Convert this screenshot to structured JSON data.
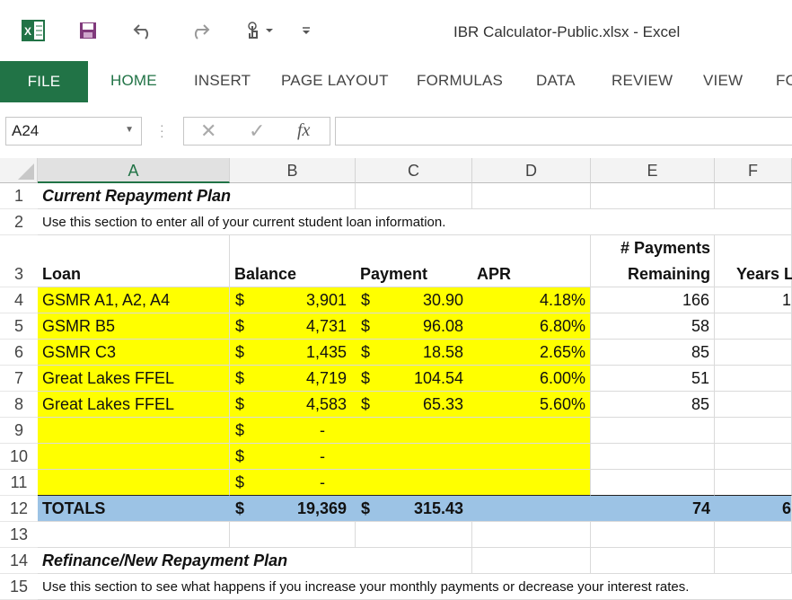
{
  "titlebar": {
    "title": "IBR Calculator-Public.xlsx - Excel"
  },
  "ribbon": {
    "tabs": [
      "FILE",
      "HOME",
      "INSERT",
      "PAGE LAYOUT",
      "FORMULAS",
      "DATA",
      "REVIEW",
      "VIEW",
      "FO"
    ]
  },
  "formula_bar": {
    "name_box": "A24",
    "content": ""
  },
  "columns": [
    "A",
    "B",
    "C",
    "D",
    "E",
    "F"
  ],
  "rows": [
    "1",
    "2",
    "3",
    "4",
    "5",
    "6",
    "7",
    "8",
    "9",
    "10",
    "11",
    "12",
    "13",
    "14",
    "15"
  ],
  "sheet": {
    "r1": {
      "a": "Current Repayment Plan"
    },
    "r2": {
      "a": "Use this section to enter all of your current student loan information."
    },
    "r3": {
      "a": "Loan",
      "b": "Balance",
      "c": "Payment",
      "d": "APR",
      "e1": "# Payments",
      "e2": "Remaining",
      "f": "Years L"
    },
    "loans": [
      {
        "name": "GSMR A1, A2, A4",
        "cur1": "$",
        "balance": "3,901",
        "cur2": "$",
        "payment": "30.90",
        "apr": "4.18%",
        "remaining": "166",
        "years": "1"
      },
      {
        "name": "GSMR B5",
        "cur1": "$",
        "balance": "4,731",
        "cur2": "$",
        "payment": "96.08",
        "apr": "6.80%",
        "remaining": "58",
        "years": ""
      },
      {
        "name": "GSMR C3",
        "cur1": "$",
        "balance": "1,435",
        "cur2": "$",
        "payment": "18.58",
        "apr": "2.65%",
        "remaining": "85",
        "years": ""
      },
      {
        "name": "Great Lakes FFEL",
        "cur1": "$",
        "balance": "4,719",
        "cur2": "$",
        "payment": "104.54",
        "apr": "6.00%",
        "remaining": "51",
        "years": ""
      },
      {
        "name": "Great Lakes FFEL",
        "cur1": "$",
        "balance": "4,583",
        "cur2": "$",
        "payment": "65.33",
        "apr": "5.60%",
        "remaining": "85",
        "years": ""
      },
      {
        "name": "",
        "cur1": "$",
        "balance": "-",
        "cur2": "",
        "payment": "",
        "apr": "",
        "remaining": "",
        "years": ""
      },
      {
        "name": "",
        "cur1": "$",
        "balance": "-",
        "cur2": "",
        "payment": "",
        "apr": "",
        "remaining": "",
        "years": ""
      },
      {
        "name": "",
        "cur1": "$",
        "balance": "-",
        "cur2": "",
        "payment": "",
        "apr": "",
        "remaining": "",
        "years": ""
      }
    ],
    "r12": {
      "a": "TOTALS",
      "cur1": "$",
      "balance": "19,369",
      "cur2": "$",
      "payment": "315.43",
      "remaining": "74",
      "years": "6"
    },
    "r14": {
      "a": "Refinance/New Repayment Plan"
    },
    "r15": {
      "a": "Use this section to see what happens if you increase your monthly payments or decrease your interest rates."
    }
  },
  "colors": {
    "excel_green": "#217346",
    "highlight": "#ffff00",
    "totals": "#9cc3e5"
  }
}
